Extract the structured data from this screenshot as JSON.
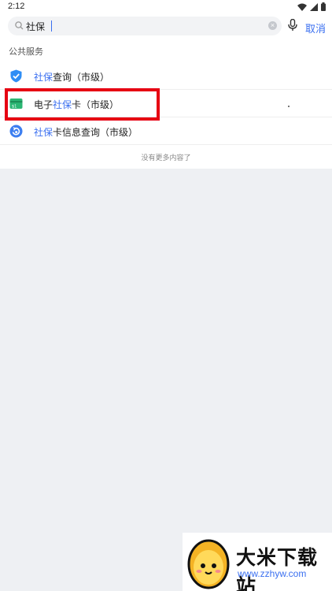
{
  "status_bar": {
    "time": "2:12"
  },
  "search": {
    "query": "社保",
    "cancel_label": "取消"
  },
  "section": {
    "title": "公共服务"
  },
  "results": [
    {
      "highlight": "社保",
      "rest": "查询（市级）",
      "icon": "shield-check-icon"
    },
    {
      "pre": "电子",
      "highlight": "社保",
      "rest": "卡（市级）",
      "icon": "card-icon"
    },
    {
      "highlight": "社保",
      "rest": "卡信息查询（市级）",
      "icon": "refresh-info-icon"
    }
  ],
  "footer": {
    "no_more": "没有更多内容了"
  },
  "watermark": {
    "brand": "大米下载站",
    "domain": "www.zzhyw.com"
  },
  "colors": {
    "accent": "#3a6ff0",
    "highlight_box": "#e60012",
    "card_icon": "#2bb673"
  }
}
